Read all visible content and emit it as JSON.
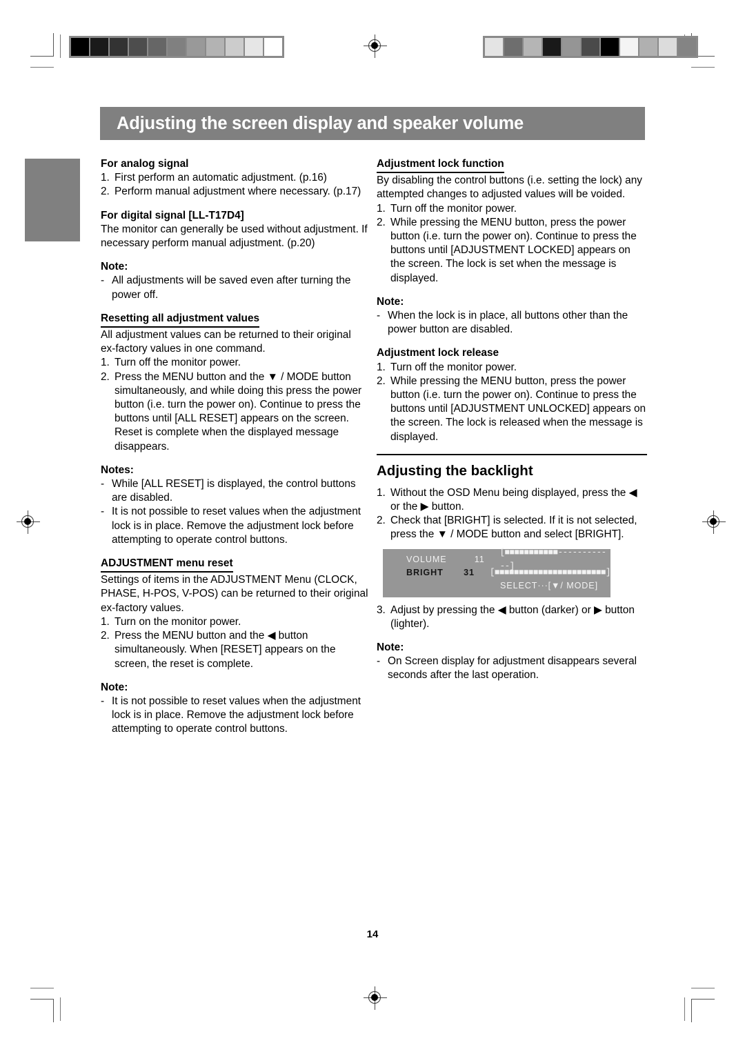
{
  "page": {
    "number": "14",
    "banner_title": "Adjusting the screen display and speaker volume",
    "accent_gray": "#808080",
    "osd_bg": "#969696"
  },
  "marks": {
    "registration_icon": "registration-target-icon",
    "wedge_left": [
      "#000000",
      "#1a1a1a",
      "#333333",
      "#4d4d4d",
      "#666666",
      "#808080",
      "#999999",
      "#b3b3b3",
      "#cccccc",
      "#e6e6e6",
      "#ffffff"
    ],
    "wedge_right": [
      "#e4e4e4",
      "#6e6e6e",
      "#b5b5b5",
      "#191919",
      "#959595",
      "#4a4a4a",
      "#000000",
      "#f4f4f4",
      "#b0b0b0",
      "#dcdcdc",
      "#848484"
    ]
  },
  "left_column": {
    "analog": {
      "heading": "For analog signal",
      "steps": [
        {
          "num": "1.",
          "text": "First perform an automatic adjustment. (p.16)"
        },
        {
          "num": "2.",
          "text": "Perform manual adjustment where necessary. (p.17)"
        }
      ]
    },
    "digital": {
      "heading": "For digital signal [LL-T17D4]",
      "body": "The monitor can generally be used without adjustment. If necessary perform manual adjustment. (p.20)"
    },
    "note1": {
      "label": "Note:",
      "items": [
        "All adjustments will be saved even after turning the power off."
      ]
    },
    "resetting": {
      "heading": "Resetting all adjustment values",
      "intro": "All adjustment values can be returned to their original ex-factory values in one command.",
      "steps": [
        {
          "num": "1.",
          "text": "Turn off the monitor power."
        },
        {
          "num": "2.",
          "text": "Press the MENU button and the ▼ / MODE button simultaneously, and while doing this press the power button (i.e. turn the power on). Continue to press the buttons until [ALL RESET] appears on the screen. Reset is complete when the displayed message disappears."
        }
      ]
    },
    "notes2": {
      "label": "Notes:",
      "items": [
        "While [ALL RESET] is displayed, the control buttons are disabled.",
        "It is not possible to reset values when the adjustment lock is in place. Remove the adjustment lock before attempting to operate control buttons."
      ]
    },
    "menu_reset": {
      "heading": "ADJUSTMENT menu reset",
      "intro": "Settings of items in the ADJUSTMENT Menu (CLOCK, PHASE, H-POS, V-POS) can be returned to their original ex-factory values.",
      "steps": [
        {
          "num": "1.",
          "text": "Turn on the monitor power."
        },
        {
          "num": "2.",
          "text": "Press the MENU button and the ◀ button simultaneously. When [RESET] appears on the screen, the reset is complete."
        }
      ]
    },
    "note3": {
      "label": "Note:",
      "items": [
        "It is not possible to reset values when the adjustment lock is in place. Remove the adjustment lock before attempting to operate control buttons."
      ]
    }
  },
  "right_column": {
    "lock_function": {
      "heading": "Adjustment lock function",
      "intro": "By disabling the control buttons (i.e. setting the lock) any attempted changes to adjusted values will be voided.",
      "steps": [
        {
          "num": "1.",
          "text": "Turn off the monitor power."
        },
        {
          "num": "2.",
          "text": "While pressing the MENU button, press the power button (i.e. turn the power on). Continue to press the buttons until [ADJUSTMENT LOCKED] appears on the screen. The lock is set when the message is displayed."
        }
      ]
    },
    "note1": {
      "label": "Note:",
      "items": [
        "When the lock is in place, all buttons other than the power button are disabled."
      ]
    },
    "lock_release": {
      "heading": "Adjustment lock release",
      "steps": [
        {
          "num": "1.",
          "text": "Turn off the monitor power."
        },
        {
          "num": "2.",
          "text": "While pressing the MENU button, press the power button (i.e. turn the power on). Continue to press the buttons until [ADJUSTMENT UNLOCKED] appears on the screen. The lock is released when the message is displayed."
        }
      ]
    },
    "backlight": {
      "heading": "Adjusting the backlight",
      "steps": [
        {
          "num": "1.",
          "text": "Without the OSD Menu being displayed, press the ◀ or the ▶ button."
        },
        {
          "num": "2.",
          "text": "Check that [BRIGHT] is selected. If it is not selected, press the ▼ / MODE button and select [BRIGHT]."
        },
        {
          "num": "3.",
          "text": "Adjust by pressing the ◀ button (darker) or ▶ button (lighter)."
        }
      ],
      "osd": {
        "rows": [
          {
            "label": "VOLUME",
            "value": "11",
            "bar": "[■■■■■■■■■■■------------]",
            "selected": false
          },
          {
            "label": "BRIGHT",
            "value": "31",
            "bar": "[■■■■■■■■■■■■■■■■■■■■■■■]",
            "selected": true
          }
        ],
        "footer": "SELECT···[▼/ MODE]"
      }
    },
    "note2": {
      "label": "Note:",
      "items": [
        "On Screen display for adjustment disappears several seconds after the last operation."
      ]
    }
  }
}
